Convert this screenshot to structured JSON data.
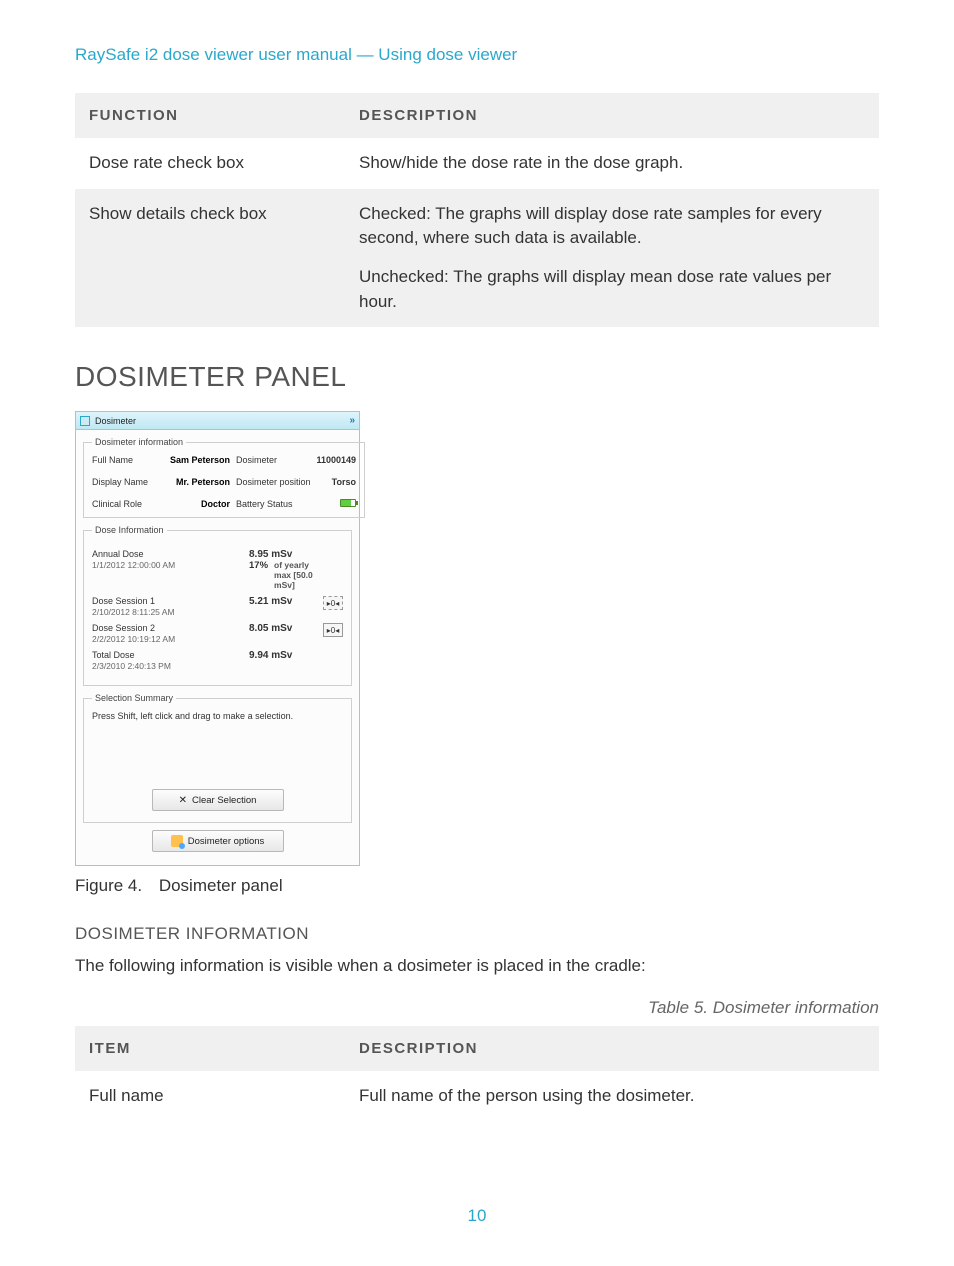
{
  "breadcrumb": "RaySafe i2 dose viewer user manual — Using dose viewer",
  "table_functions": {
    "col1_header": "FUNCTION",
    "col2_header": "DESCRIPTION",
    "rows": [
      {
        "func": "Dose rate check box",
        "desc": "Show/hide the dose rate in the dose graph."
      },
      {
        "func": "Show details check box",
        "desc1": "Checked: The graphs will display dose rate samples for every second, where such data is available.",
        "desc2": "Unchecked: The graphs will display mean dose rate values per hour."
      }
    ]
  },
  "section_heading": "DOSIMETER PANEL",
  "panel": {
    "title": "Dosimeter",
    "group_info_label": "Dosimeter information",
    "full_name_lbl": "Full Name",
    "full_name_val": "Sam Peterson",
    "dosimeter_lbl": "Dosimeter",
    "dosimeter_val": "11000149",
    "display_name_lbl": "Display Name",
    "display_name_val": "Mr. Peterson",
    "dos_pos_lbl": "Dosimeter position",
    "dos_pos_val": "Torso",
    "clinical_role_lbl": "Clinical Role",
    "clinical_role_val": "Doctor",
    "battery_lbl": "Battery Status",
    "group_dose_label": "Dose Information",
    "annual_dose_lbl": "Annual Dose",
    "annual_dose_ts": "1/1/2012 12:00:00 AM",
    "annual_dose_val": "8.95 mSv",
    "annual_pct": "17%",
    "annual_pct_note": "of yearly max [50.0 mSv]",
    "session1_lbl": "Dose Session 1",
    "session1_ts": "2/10/2012 8:11:25 AM",
    "session1_val": "5.21 mSv",
    "session2_lbl": "Dose Session 2",
    "session2_ts": "2/2/2012 10:19:12 AM",
    "session2_val": "8.05 mSv",
    "total_dose_lbl": "Total Dose",
    "total_dose_ts": "2/3/2010 2:40:13 PM",
    "total_dose_val": "9.94 mSv",
    "group_selection_label": "Selection Summary",
    "selection_text": "Press Shift, left click and drag to make a selection.",
    "clear_selection_btn": "Clear Selection",
    "dosimeter_options_btn": "Dosimeter options",
    "reset_symbol": "▸0◂"
  },
  "figure_caption_num": "Figure 4.",
  "figure_caption_text": "Dosimeter panel",
  "subheading": "DOSIMETER INFORMATION",
  "intro_text": "The following information is visible when a dosimeter is placed in the cradle:",
  "table5_caption": "Table 5.    Dosimeter information",
  "table_items": {
    "col1_header": "ITEM",
    "col2_header": "DESCRIPTION",
    "rows": [
      {
        "item": "Full name",
        "desc": "Full name of the person using the dosimeter."
      }
    ]
  },
  "page_number": "10"
}
